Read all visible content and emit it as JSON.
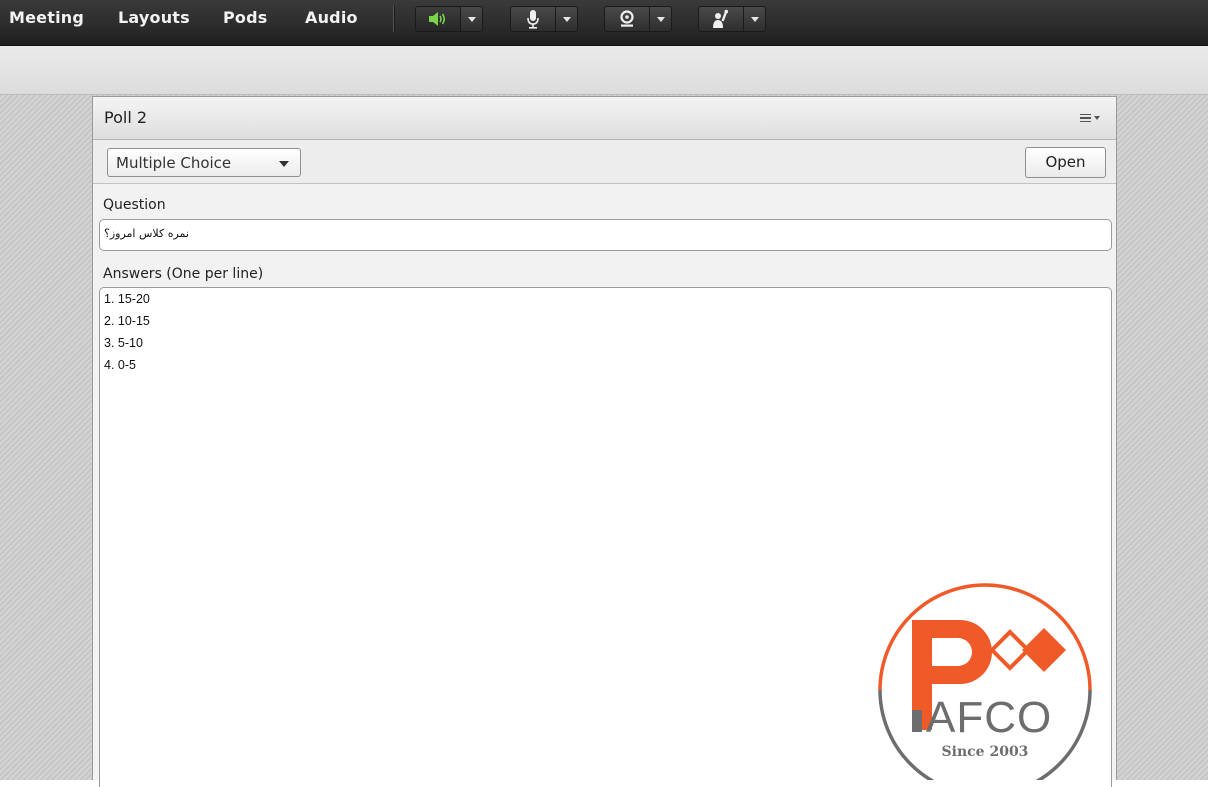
{
  "menubar": {
    "items": [
      "Meeting",
      "Layouts",
      "Pods",
      "Audio"
    ]
  },
  "controls": [
    {
      "icon": "speaker-icon",
      "color": "#7ad54a"
    },
    {
      "icon": "microphone-icon",
      "color": "#f0f0f0"
    },
    {
      "icon": "webcam-icon",
      "color": "#f0f0f0"
    },
    {
      "icon": "raise-hand-icon",
      "color": "#f0f0f0"
    }
  ],
  "pod": {
    "title": "Poll 2",
    "type_select": "Multiple Choice",
    "open_button": "Open",
    "question_label": "Question",
    "question_value": "نمره کلاس امروز؟",
    "answers_label": "Answers (One per line)",
    "answers": [
      "1. 15-20",
      "2. 10-15",
      "3. 5-10",
      "4. 0-5"
    ]
  },
  "logo": {
    "letters": "AFCO",
    "tagline": "Since 2003",
    "accent_color": "#f05a28",
    "ring_gray": "#6d6d6d"
  }
}
